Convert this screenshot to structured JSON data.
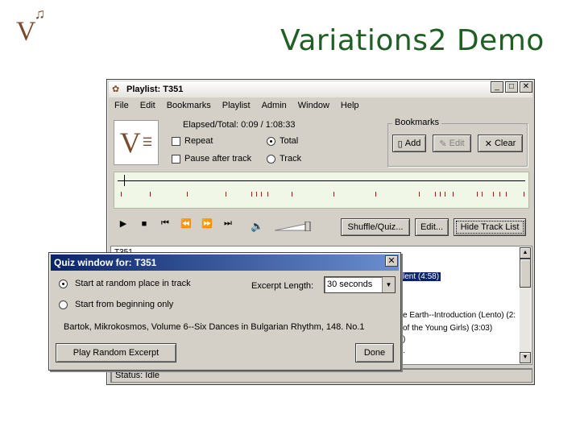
{
  "slide": {
    "title": "Variations2 Demo",
    "logo": "V",
    "logo_note": "♫"
  },
  "window": {
    "title": "Playlist: T351",
    "buttons": [
      "_",
      "□",
      "✕"
    ],
    "menu": [
      "File",
      "Edit",
      "Bookmarks",
      "Playlist",
      "Admin",
      "Window",
      "Help"
    ],
    "elapsed_label": "Elapsed/Total:",
    "elapsed_value": "0:09 / 1:08:33",
    "repeat_label": "Repeat",
    "pause_label": "Pause after track",
    "total_label": "Total",
    "track_label": "Track",
    "total_selected": true,
    "bookmarks": {
      "label": "Bookmarks",
      "add": "Add",
      "edit": "Edit",
      "clear": "Clear"
    },
    "transport": [
      "▶",
      "■",
      "⏮",
      "⏪",
      "⏩",
      "⏭"
    ],
    "shuffle_button": "Shuffle/Quiz...",
    "edit_button": "Edit...",
    "hide_button": "Hide Track List",
    "tracklist": {
      "header": "T351",
      "rows": [
        "lent (4:58)",
        "e Earth--Introduction (Lento) (2:",
        "of the Young Girls) (3:03)",
        ")",
        "."
      ]
    },
    "status": "Status: Idle"
  },
  "quiz": {
    "title": "Quiz window for: T351",
    "close": "✕",
    "start_random": "Start at random place in track",
    "start_beginning": "Start from beginning only",
    "excerpt_label": "Excerpt Length:",
    "excerpt_value": "30 seconds",
    "current_track": "Bartok, Mikrokosmos, Volume 6--Six Dances in Bulgarian Rhythm, 148. No.1",
    "play_button": "Play Random Excerpt",
    "done_button": "Done"
  }
}
